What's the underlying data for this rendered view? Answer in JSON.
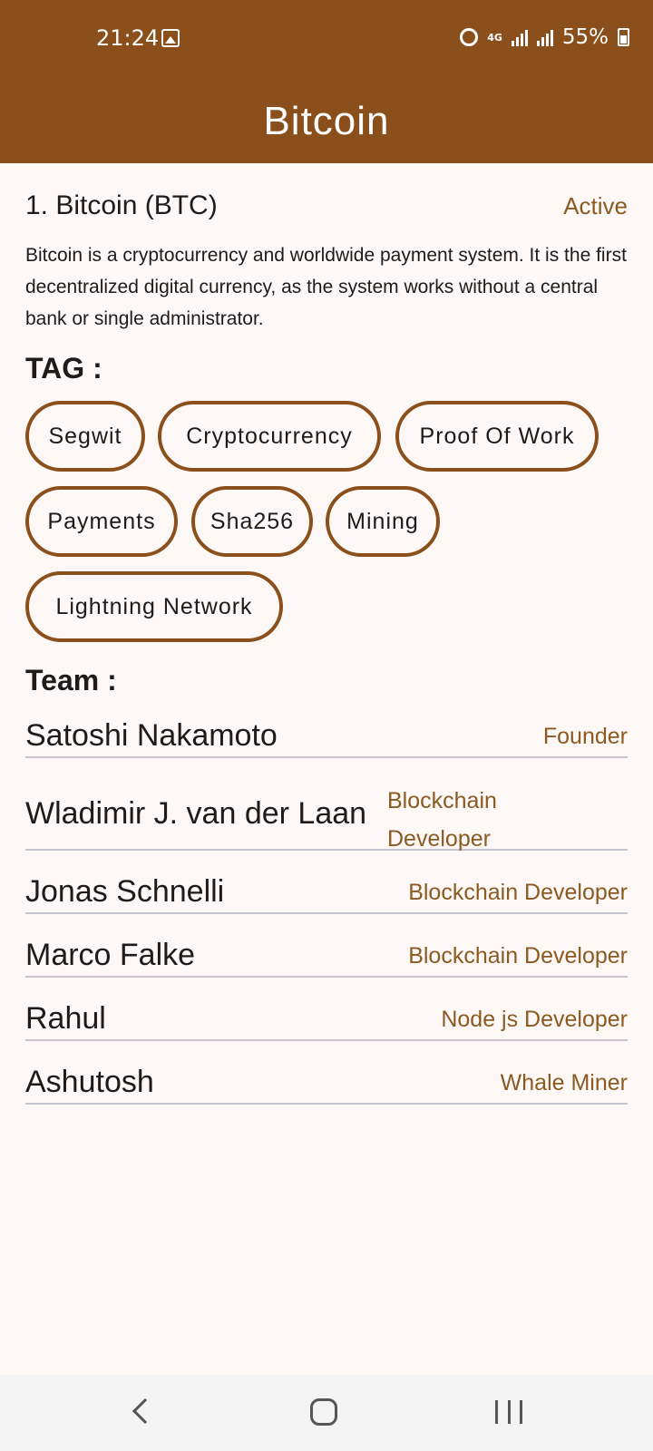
{
  "status_bar": {
    "time": "21:24",
    "network": "4G",
    "battery": "55%"
  },
  "app_bar": {
    "title": "Bitcoin"
  },
  "coin": {
    "name": "1. Bitcoin (BTC)",
    "status": "Active",
    "description": "Bitcoin is a cryptocurrency and worldwide payment system. It is the first decentralized digital currency, as the system works without a central bank or single administrator."
  },
  "tags": {
    "title": "TAG :",
    "items": [
      "Segwit",
      "Cryptocurrency",
      "Proof Of Work",
      "Payments",
      "Sha256",
      "Mining",
      "Lightning Network"
    ]
  },
  "team": {
    "title": "Team :",
    "members": [
      {
        "name": "Satoshi Nakamoto",
        "role": "Founder"
      },
      {
        "name": "Wladimir J. van der Laan",
        "role": "Blockchain Developer"
      },
      {
        "name": "Jonas Schnelli",
        "role": "Blockchain Developer"
      },
      {
        "name": "Marco Falke",
        "role": "Blockchain Developer"
      },
      {
        "name": "Rahul",
        "role": "Node js Developer"
      },
      {
        "name": "Ashutosh",
        "role": "Whale Miner"
      }
    ]
  },
  "colors": {
    "primary": "#8b4f1b",
    "accent_text": "#8b5a22",
    "background": "#fdf8f6"
  }
}
